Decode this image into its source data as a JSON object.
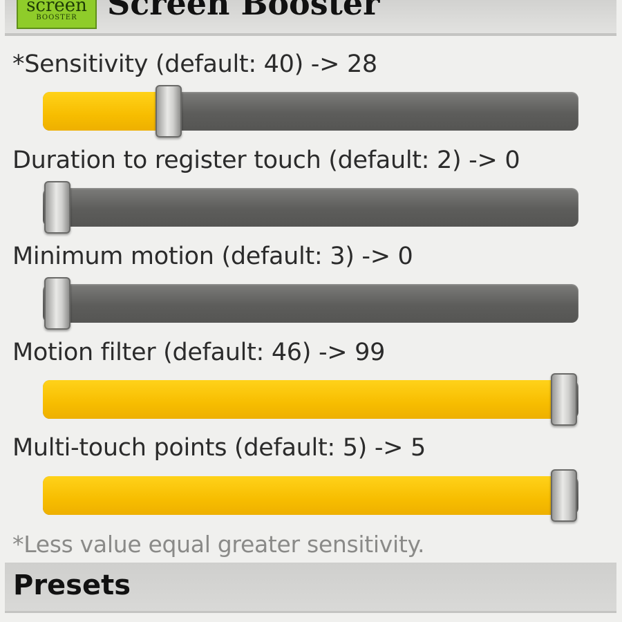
{
  "header": {
    "icon_text_top": "screen",
    "icon_text_bottom": "BOOSTER",
    "title": "Screen Booster"
  },
  "settings": [
    {
      "label": "*Sensitivity (default: 40) -> 28",
      "min": 0,
      "max": 99,
      "value": 28,
      "fill_fraction": 0.22
    },
    {
      "label": "Duration to register touch (default: 2) -> 0",
      "min": 0,
      "max": 10,
      "value": 0,
      "fill_fraction": 0.0
    },
    {
      "label": "Minimum motion (default: 3) -> 0",
      "min": 0,
      "max": 10,
      "value": 0,
      "fill_fraction": 0.0
    },
    {
      "label": "Motion filter (default: 46) -> 99",
      "min": 0,
      "max": 99,
      "value": 99,
      "fill_fraction": 1.0
    },
    {
      "label": "Multi-touch points (default: 5) -> 5",
      "min": 0,
      "max": 5,
      "value": 5,
      "fill_fraction": 1.0
    }
  ],
  "footnote": "*Less value equal greater sensitivity.",
  "presets": {
    "title": "Presets"
  },
  "colors": {
    "slider_fill": "#f7bd00",
    "slider_track": "#5d5d5b",
    "icon_green": "#8fcc2a"
  }
}
